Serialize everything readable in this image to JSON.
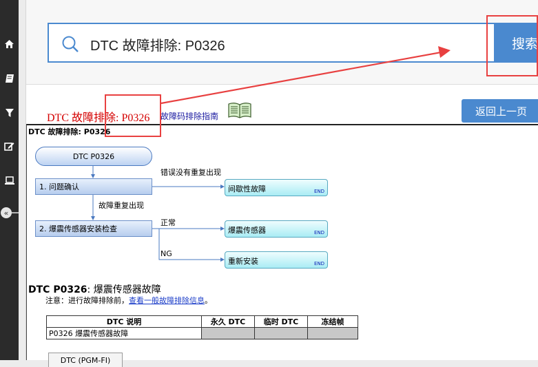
{
  "sidebar": {
    "items": [
      {
        "icon": "home-icon"
      },
      {
        "icon": "book-icon"
      },
      {
        "icon": "filter-icon"
      },
      {
        "icon": "edit-icon"
      },
      {
        "icon": "laptop-icon"
      },
      {
        "icon": "collapse-icon",
        "glyph": "«"
      }
    ]
  },
  "search": {
    "value": "DTC 故障排除: P0326",
    "button_label": "搜索"
  },
  "header": {
    "title": "DTC 故障排除: P0326",
    "guide_link": "故障码排除指南",
    "back_button": "返回上一页"
  },
  "doc": {
    "heading": "DTC 故障排除: P0326",
    "flow": {
      "start": "DTC P0326",
      "step1": "1.  问题确认",
      "step2": "2.  爆震传感器安装检查",
      "label_not_reproduced": "错误没有重复出现",
      "label_reproduced": "故障重复出现",
      "label_normal": "正常",
      "label_ng": "NG",
      "result1": "间歇性故障",
      "result2": "爆震传感器",
      "result3": "重新安装",
      "end": "END"
    },
    "section_title_bold": "DTC P0326",
    "section_title_rest": ": 爆震传感器故障",
    "note_prefix": "注意：进行故障排除前，",
    "note_link": "查看一般故障排除信息",
    "note_suffix": "。",
    "table": {
      "headers": [
        "DTC 说明",
        "永久 DTC",
        "临时 DTC",
        "冻结帧"
      ],
      "rows": [
        [
          "P0326 爆震传感器故障",
          "",
          "",
          ""
        ]
      ]
    },
    "bottom_tab": "DTC (PGM-FI)"
  },
  "colors": {
    "accent": "#4a89cf",
    "annotation_red": "#e84040",
    "title_red": "#d40000"
  }
}
